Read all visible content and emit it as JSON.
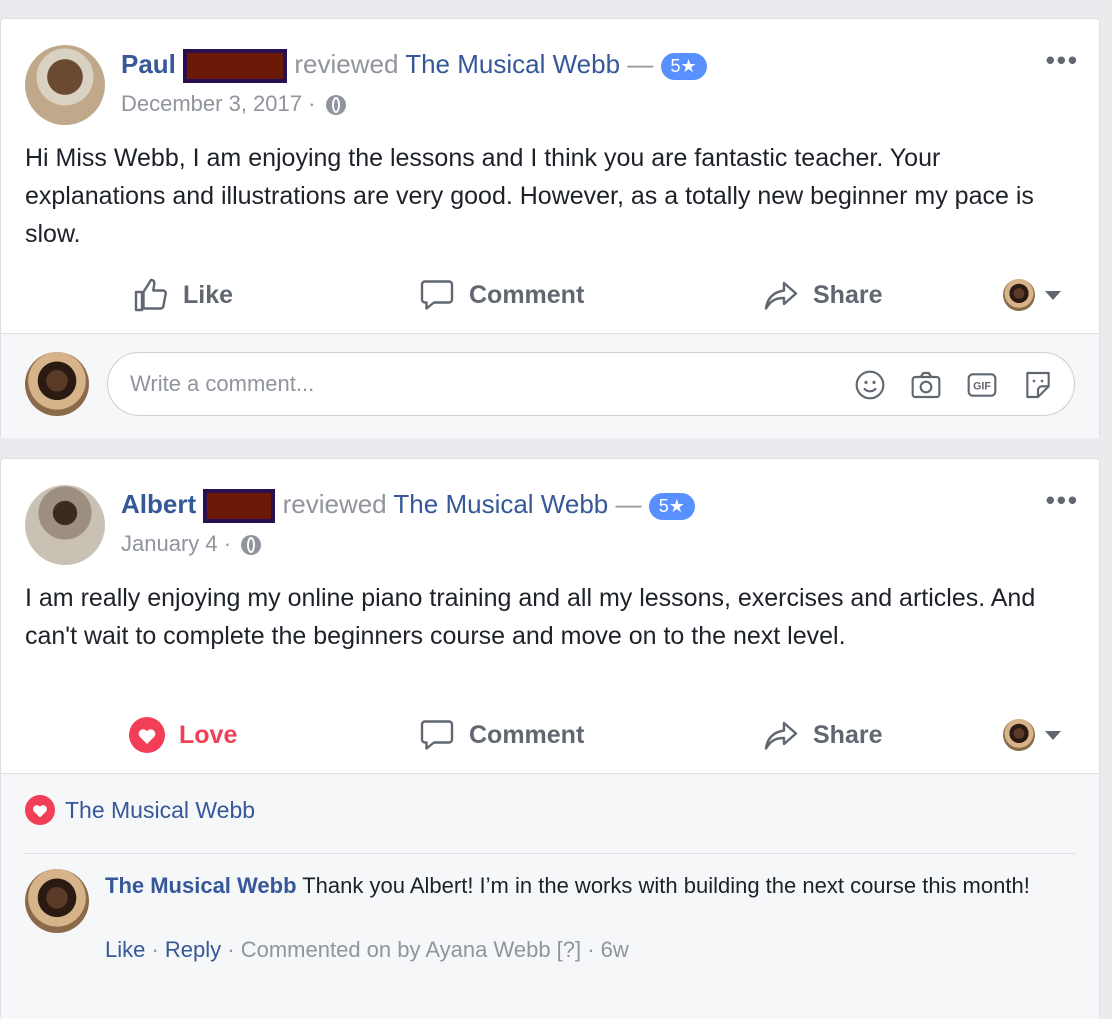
{
  "posts": [
    {
      "author": "Paul",
      "verb": "reviewed",
      "page": "The Musical Webb",
      "dash": "—",
      "rating": "5★",
      "date": "December 3, 2017 ·",
      "text": "Hi Miss Webb, I am enjoying the lessons and I think you are fantastic teacher. Your explanations and illustrations are very good. However, as a totally new beginner my pace is slow.",
      "reaction_label": "Like",
      "comment_label": "Comment",
      "share_label": "Share",
      "more": "•••"
    },
    {
      "author": "Albert",
      "verb": "reviewed",
      "page": "The Musical Webb",
      "dash": "—",
      "rating": "5★",
      "date": "January 4 ·",
      "text": "I am really enjoying my online piano training and all my lessons, exercises and articles. And can't wait to complete the beginners course and move on to the next level.",
      "reaction_label": "Love",
      "comment_label": "Comment",
      "share_label": "Share",
      "more": "•••"
    }
  ],
  "comment_box": {
    "placeholder": "Write a comment..."
  },
  "reactions": {
    "name": "The Musical Webb"
  },
  "reply": {
    "author": "The Musical Webb",
    "text": "Thank you Albert! I’m in the works with building the next course this month!",
    "like": "Like",
    "sep1": " · ",
    "reply_label": "Reply",
    "meta": " · Commented on by Ayana Webb [?] · 6w"
  },
  "colors": {
    "link": "#365899",
    "love": "#f33e58",
    "rating_badge": "#5890ff",
    "muted": "#90949c"
  },
  "icons": [
    "thumbs-up-icon",
    "love-heart-icon",
    "comment-bubble-icon",
    "share-arrow-icon",
    "globe-icon",
    "emoji-icon",
    "camera-icon",
    "gif-icon",
    "sticker-icon",
    "more-dots-icon"
  ]
}
